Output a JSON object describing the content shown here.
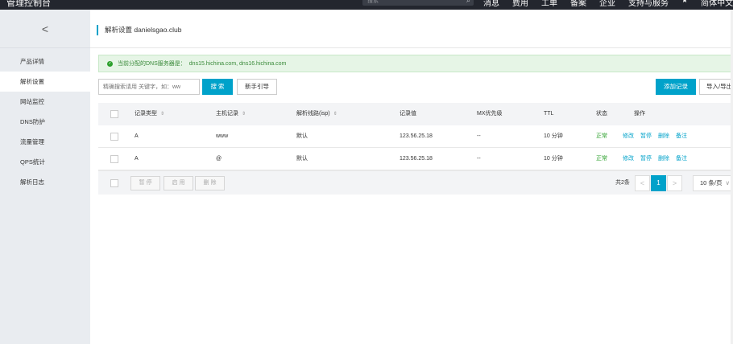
{
  "topbar": {
    "brand": "管理控制台",
    "search_placeholder": "搜索",
    "nav": [
      "消息",
      "费用",
      "工单",
      "备案",
      "企业",
      "支持与服务"
    ],
    "user": "简体中文"
  },
  "sidebar": {
    "collapse_glyph": "<",
    "items": [
      {
        "label": "产品详情"
      },
      {
        "label": "解析设置"
      },
      {
        "label": "网站监控"
      },
      {
        "label": "DNS防护"
      },
      {
        "label": "流量管理"
      },
      {
        "label": "QPS统计"
      },
      {
        "label": "解析日志"
      }
    ]
  },
  "page": {
    "title": "解析设置 danielsgao.club"
  },
  "alert": {
    "label": "当前分配的DNS服务器是：",
    "servers": "dns15.hichina.com, dns16.hichina.com",
    "color": "#2ca02c"
  },
  "toolbar": {
    "search_placeholder": "精确搜索请用 关键字，如：ww",
    "search_button": "搜 索",
    "guide_button": "新手引导",
    "add_button": "添加记录",
    "io_button": "导入/导出"
  },
  "table": {
    "headers": {
      "type": "记录类型",
      "host": "主机记录",
      "line": "解析线路(isp)",
      "value": "记录值",
      "mx": "MX优先级",
      "ttl": "TTL",
      "status": "状态",
      "actions": "操作"
    },
    "sort_glyph": "⇕",
    "rows": [
      {
        "type": "A",
        "host": "www",
        "line": "默认",
        "value": "123.56.25.18",
        "mx": "--",
        "ttl": "10 分钟",
        "status": "正常",
        "actions": [
          "修改",
          "暂停",
          "删除",
          "备注"
        ]
      },
      {
        "type": "A",
        "host": "@",
        "line": "默认",
        "value": "123.56.25.18",
        "mx": "--",
        "ttl": "10 分钟",
        "status": "正常",
        "actions": [
          "修改",
          "暂停",
          "删除",
          "备注"
        ]
      }
    ]
  },
  "footer": {
    "batch_buttons": [
      "暂 停",
      "启 用",
      "删 除"
    ],
    "total": "共2条",
    "prev": "<",
    "current_page": "1",
    "next": ">",
    "page_size": "10 条/页"
  },
  "colors": {
    "accent": "#00a2ca",
    "topbar": "#23262e",
    "sidebar": "#e9ecf0",
    "ok": "#2ca02c"
  }
}
